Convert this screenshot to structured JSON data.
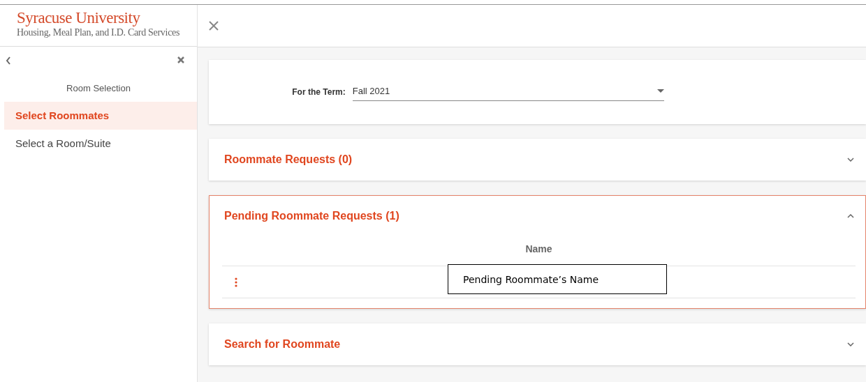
{
  "header": {
    "title": "Syracuse University",
    "subtitle": "Housing, Meal Plan, and I.D. Card Services"
  },
  "sidebar": {
    "heading": "Room Selection",
    "items": [
      {
        "label": "Select Roommates",
        "selected": true
      },
      {
        "label": "Select a Room/Suite",
        "selected": false
      }
    ]
  },
  "term": {
    "label": "For the Term:",
    "value": "Fall 2021"
  },
  "sections": [
    {
      "title": "Roommate Requests (0)",
      "expanded": false
    },
    {
      "title": "Pending Roommate Requests (1)",
      "expanded": true,
      "table": {
        "columns": [
          "Name"
        ],
        "rows": [
          [
            "Pending Roommate’s Name"
          ]
        ]
      }
    },
    {
      "title": "Search for Roommate",
      "expanded": false
    }
  ]
}
